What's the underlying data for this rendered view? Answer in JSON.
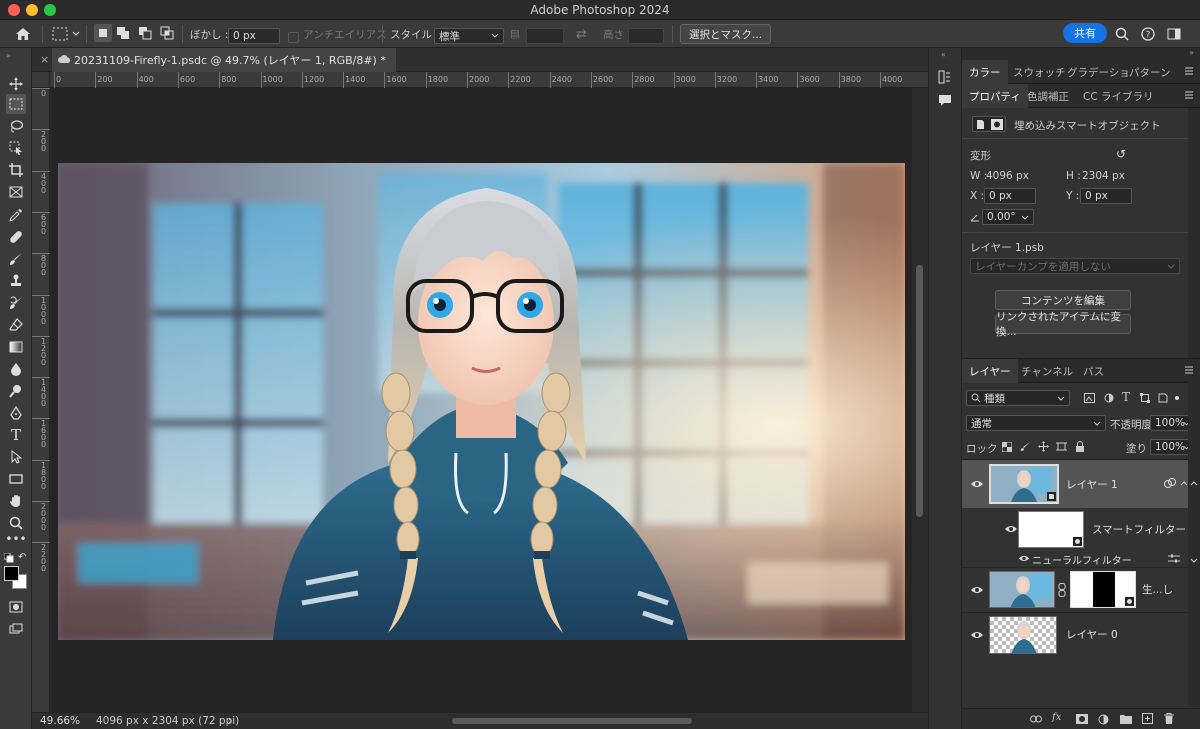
{
  "window": {
    "title": "Adobe Photoshop 2024"
  },
  "options": {
    "feather_label": "ぼかし :",
    "feather_value": "0 px",
    "antialias_label": "アンチエイリアス",
    "style_label": "スタイル :",
    "style_value": "標準",
    "height_label": "高さ :",
    "select_mask_button": "選択とマスク...",
    "share_button": "共有"
  },
  "document": {
    "tab_title": "20231109-Firefly-1.psdc @ 49.7% (レイヤー 1, RGB/8#) *"
  },
  "rulers": {
    "horizontal": [
      "0",
      "200",
      "400",
      "600",
      "800",
      "1000",
      "1200",
      "1400",
      "1600",
      "1800",
      "2000",
      "2200",
      "2400",
      "2600",
      "2800",
      "3000",
      "3200",
      "3400",
      "3600",
      "3800",
      "4000"
    ],
    "vertical": [
      "0",
      "200",
      "400",
      "600",
      "800",
      "1000",
      "1200",
      "1400",
      "1600",
      "1800",
      "2000",
      "2200"
    ]
  },
  "status": {
    "zoom": "49.66%",
    "doc_info": "4096 px x 2304 px (72 ppi)"
  },
  "top_panel": {
    "tabs": [
      "カラー",
      "スウォッチ",
      "グラデーショ",
      "パターン"
    ]
  },
  "properties": {
    "tabs": [
      "プロパティ",
      "色調補正",
      "CC ライブラリ"
    ],
    "object_type": "埋め込みスマートオブジェクト",
    "transform_label": "変形",
    "w_label": "W :",
    "w_value": "4096 px",
    "h_label": "H :",
    "h_value": "2304 px",
    "x_label": "X :",
    "x_value": "0 px",
    "y_label": "Y :",
    "y_value": "0 px",
    "angle_value": "0.00°",
    "file_name": "レイヤー 1.psb",
    "layer_comp": "レイヤーカンプを適用しない",
    "edit_contents_button": "コンテンツを編集",
    "convert_linked_button": "リンクされたアイテムに変換..."
  },
  "layers_panel": {
    "tabs": [
      "レイヤー",
      "チャンネル",
      "パス"
    ],
    "filter_kind": "種類",
    "blend_mode": "通常",
    "opacity_label": "不透明度 :",
    "opacity_value": "100%",
    "lock_label": "ロック :",
    "fill_label": "塗り :",
    "fill_value": "100%",
    "layers": [
      {
        "name": "レイヤー 1"
      },
      {
        "name": "スマートフィルター"
      },
      {
        "name": "ニューラルフィルター"
      },
      {
        "name": "生...し"
      },
      {
        "name": "レイヤー 0"
      }
    ]
  }
}
